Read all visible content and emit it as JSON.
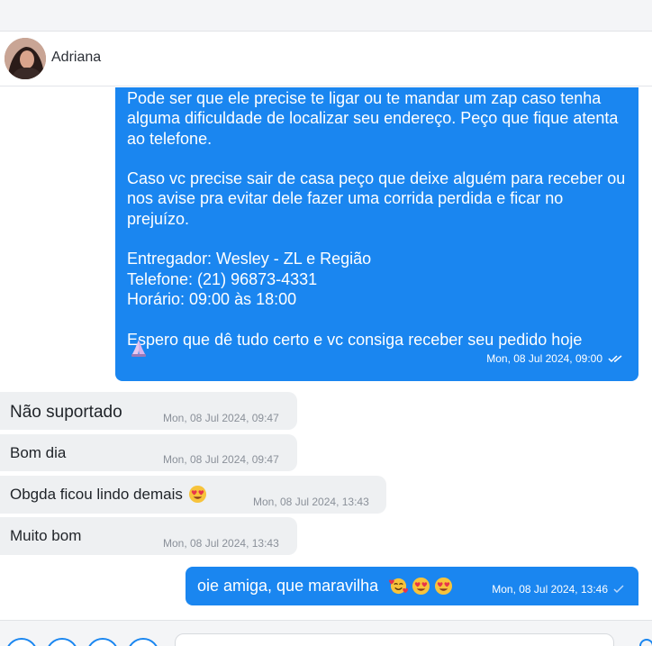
{
  "contact": {
    "name": "Adriana"
  },
  "messages": {
    "m1": {
      "text": "Pode ser que ele precise te ligar ou te mandar um zap caso tenha alguma dificuldade de localizar seu endereço. Peço que fique atenta ao telefone.\n\nCaso vc precise sair de casa peço que deixe alguém para receber ou nos avise pra evitar dele fazer uma corrida perdida e ficar no prejuízo.\n\nEntregador: Wesley - ZL e Região\nTelefone: (21) 96873-4331\nHorário: 09:00 às 18:00\n\nEspero que dê tudo certo e vc consiga receber seu pedido hoje",
      "time": "Mon, 08 Jul 2024, 09:00",
      "status": "read",
      "emoji": "folded-hands"
    },
    "m2": {
      "text": "Não suportado",
      "time": "Mon, 08 Jul 2024, 09:47"
    },
    "m3": {
      "text": "Bom dia",
      "time": "Mon, 08 Jul 2024, 09:47"
    },
    "m4": {
      "text": "Obgda ficou lindo demais",
      "time": "Mon, 08 Jul 2024, 13:43",
      "emoji": "heart-eyes"
    },
    "m5": {
      "text": "Muito bom",
      "time": "Mon, 08 Jul 2024, 13:43"
    },
    "m6": {
      "text": "oie amiga, que maravilha",
      "time": "Mon, 08 Jul 2024, 13:46",
      "status": "sent",
      "emojis": [
        "smiling-face-with-hearts",
        "heart-eyes",
        "heart-eyes"
      ]
    }
  },
  "colors": {
    "outgoing": "#1a86f0",
    "incoming": "#eef0f2",
    "accent": "#1a86f0"
  }
}
